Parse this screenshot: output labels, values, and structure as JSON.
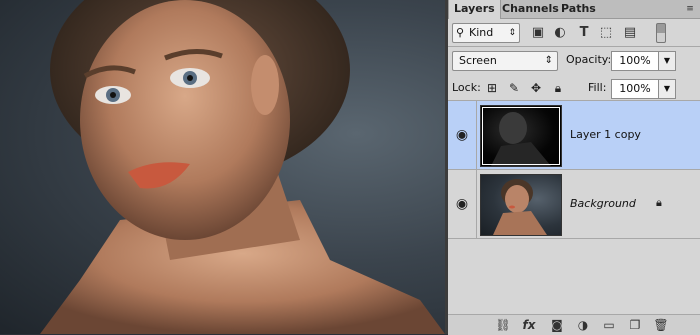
{
  "panel": {
    "tabs": [
      {
        "label": "Layers",
        "active": true
      },
      {
        "label": "Channels",
        "active": false
      },
      {
        "label": "Paths",
        "active": false
      }
    ],
    "filter": {
      "kind_label": "Kind"
    },
    "blend_mode": "Screen",
    "opacity_label": "Opacity:",
    "opacity_value": "100%",
    "lock_label": "Lock:",
    "fill_label": "Fill:",
    "fill_value": "100%",
    "layers": [
      {
        "name": "Layer 1 copy",
        "selected": true,
        "visible": true,
        "locked": false
      },
      {
        "name": "Background",
        "selected": false,
        "visible": true,
        "locked": true
      }
    ],
    "accent_color": "#b9d0f7"
  }
}
